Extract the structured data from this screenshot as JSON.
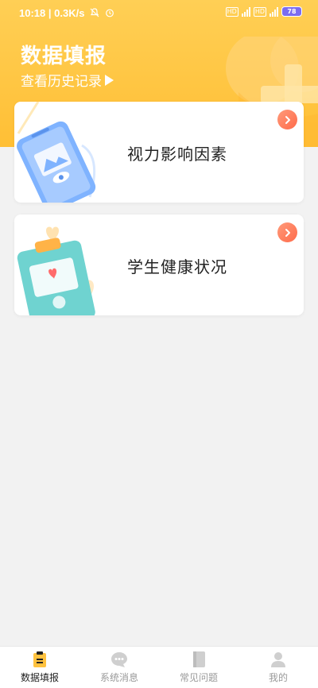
{
  "status_bar": {
    "time": "10:18",
    "speed": "0.3K/s",
    "battery": "78"
  },
  "header": {
    "title": "数据填报",
    "history_link": "查看历史记录"
  },
  "cards": [
    {
      "label": "视力影响因素"
    },
    {
      "label": "学生健康状况"
    }
  ],
  "tabs": [
    {
      "label": "数据填报",
      "active": true
    },
    {
      "label": "系统消息",
      "active": false
    },
    {
      "label": "常见问题",
      "active": false
    },
    {
      "label": "我的",
      "active": false
    }
  ],
  "colors": {
    "accent": "#ffc23f",
    "arrow": "#ff7a5a",
    "text": "#222222"
  }
}
